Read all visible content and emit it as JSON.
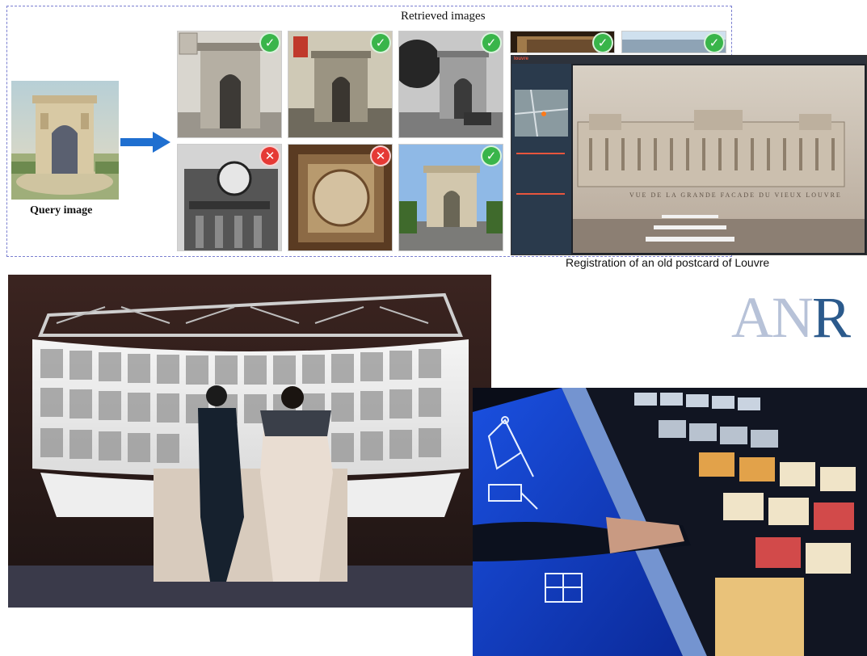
{
  "retrieval": {
    "title": "Retrieved images",
    "query_label": "Query image",
    "results": [
      {
        "status": "match",
        "icon": "check-icon"
      },
      {
        "status": "match",
        "icon": "check-icon"
      },
      {
        "status": "match",
        "icon": "check-icon"
      },
      {
        "status": "match",
        "icon": "check-icon"
      },
      {
        "status": "match",
        "icon": "check-icon"
      },
      {
        "status": "mismatch",
        "icon": "cross-icon"
      },
      {
        "status": "mismatch",
        "icon": "cross-icon"
      },
      {
        "status": "match",
        "icon": "check-icon"
      }
    ],
    "check_glyph": "✓",
    "cross_glyph": "✕",
    "colors": {
      "match": "#39b54a",
      "mismatch": "#e53935",
      "arrow": "#1f6fd0",
      "border": "#7a7fd0"
    }
  },
  "viewer": {
    "brand": "louvre",
    "postcard_caption": "VUE DE LA GRANDE FACADE DU VIEUX LOUVRE"
  },
  "registration_caption": "Registration of an old postcard of Louvre",
  "logo": {
    "text_a": "AN",
    "text_b": "R",
    "color_a": "#b7c2d8",
    "color_b": "#2b5a8c"
  }
}
